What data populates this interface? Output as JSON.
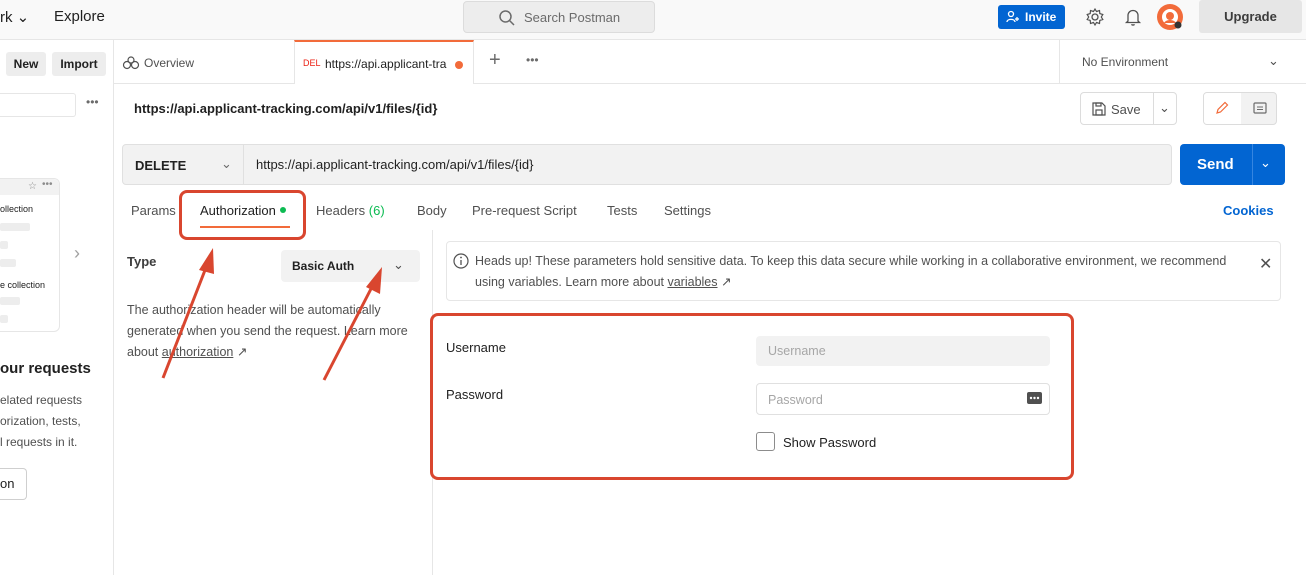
{
  "topbar": {
    "workspace_label": "rk",
    "explore_label": "Explore",
    "search_placeholder": "Search Postman",
    "invite_label": "Invite",
    "upgrade_label": "Upgrade"
  },
  "sidebar": {
    "new_label": "New",
    "import_label": "Import",
    "card_item_1": "ollection",
    "card_item_2": "e collection",
    "heading": "our requests",
    "description_lines": [
      "elated requests",
      "orization, tests,",
      "l requests in it."
    ],
    "button_label": "on"
  },
  "tabs": {
    "overview_label": "Overview",
    "active_method": "DEL",
    "active_url": "https://api.applicant-tra",
    "environment_label": "No Environment"
  },
  "request": {
    "title": "https://api.applicant-tracking.com/api/v1/files/{id}",
    "save_label": "Save",
    "method": "DELETE",
    "url": "https://api.applicant-tracking.com/api/v1/files/{id}",
    "send_label": "Send"
  },
  "request_tabs": {
    "params": "Params",
    "authorization": "Authorization",
    "headers": "Headers",
    "headers_count": "(6)",
    "body": "Body",
    "prerequest": "Pre-request Script",
    "tests": "Tests",
    "settings": "Settings",
    "cookies": "Cookies"
  },
  "auth": {
    "type_label": "Type",
    "type_value": "Basic Auth",
    "description_prefix": "The authorization header will be automatically generated when you send the request. Learn more about ",
    "description_link": "authorization",
    "description_suffix": " ↗",
    "headsup_text": "Heads up! These parameters hold sensitive data. To keep this data secure while working in a collaborative environment, we recommend using variables. Learn more about ",
    "headsup_link": "variables",
    "headsup_suffix": " ↗",
    "username_label": "Username",
    "username_placeholder": "Username",
    "password_label": "Password",
    "password_placeholder": "Password",
    "show_password_label": "Show Password"
  },
  "colors": {
    "accent": "#f26b3a",
    "primary": "#0265d2",
    "annotation": "#d9462f",
    "success": "#0cbb52"
  }
}
